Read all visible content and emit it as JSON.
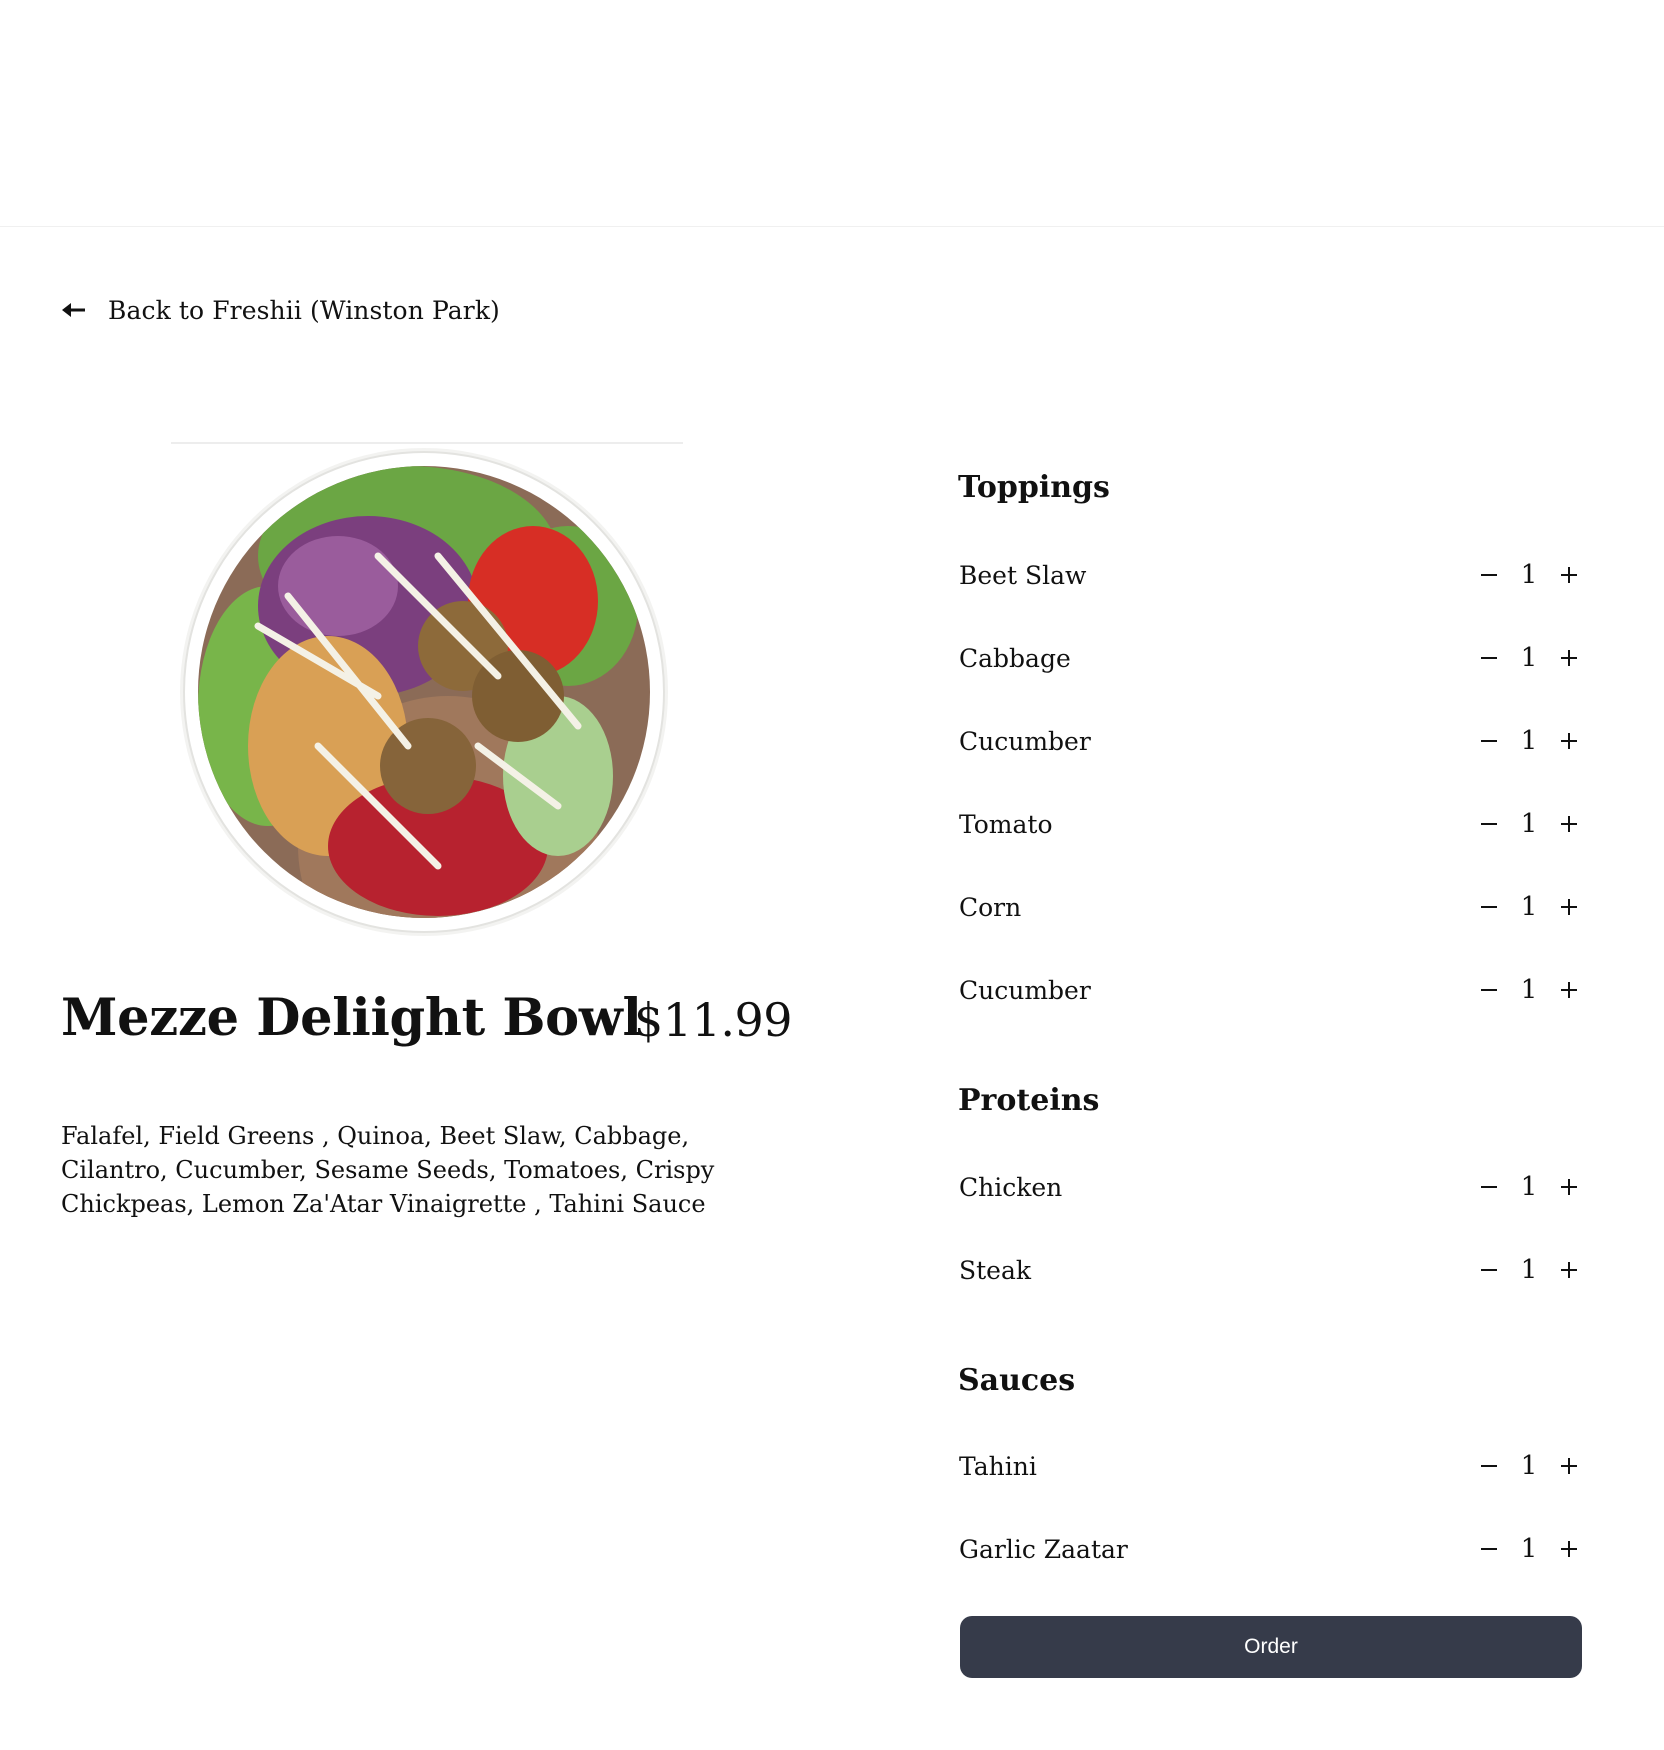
{
  "back_link": {
    "label": "Back to Freshii (Winston Park)"
  },
  "product": {
    "name": "Mezze Deliight Bowl",
    "price": "$11.99",
    "description": "Falafel, Field Greens , Quinoa, Beet Slaw, Cabbage, Cilantro, Cucumber, Sesame Seeds, Tomatoes, Crispy Chickpeas, Lemon Za'Atar Vinaigrette , Tahini Sauce"
  },
  "sections": [
    {
      "title": "Toppings",
      "items": [
        {
          "name": "Beet Slaw",
          "qty": "1"
        },
        {
          "name": "Cabbage",
          "qty": "1"
        },
        {
          "name": "Cucumber",
          "qty": "1"
        },
        {
          "name": "Tomato",
          "qty": "1"
        },
        {
          "name": "Corn",
          "qty": "1"
        },
        {
          "name": "Cucumber",
          "qty": "1"
        }
      ]
    },
    {
      "title": "Proteins",
      "items": [
        {
          "name": "Chicken",
          "qty": "1"
        },
        {
          "name": "Steak",
          "qty": "1"
        }
      ]
    },
    {
      "title": "Sauces",
      "items": [
        {
          "name": "Tahini",
          "qty": "1"
        },
        {
          "name": "Garlic Zaatar",
          "qty": "1"
        }
      ]
    }
  ],
  "icons": {
    "back": "arrow-left-icon",
    "decrement": "minus-icon",
    "increment": "plus-icon"
  },
  "order_button": {
    "label": "Order"
  },
  "colors": {
    "order_button_bg": "#363b4a",
    "text": "#111111"
  }
}
